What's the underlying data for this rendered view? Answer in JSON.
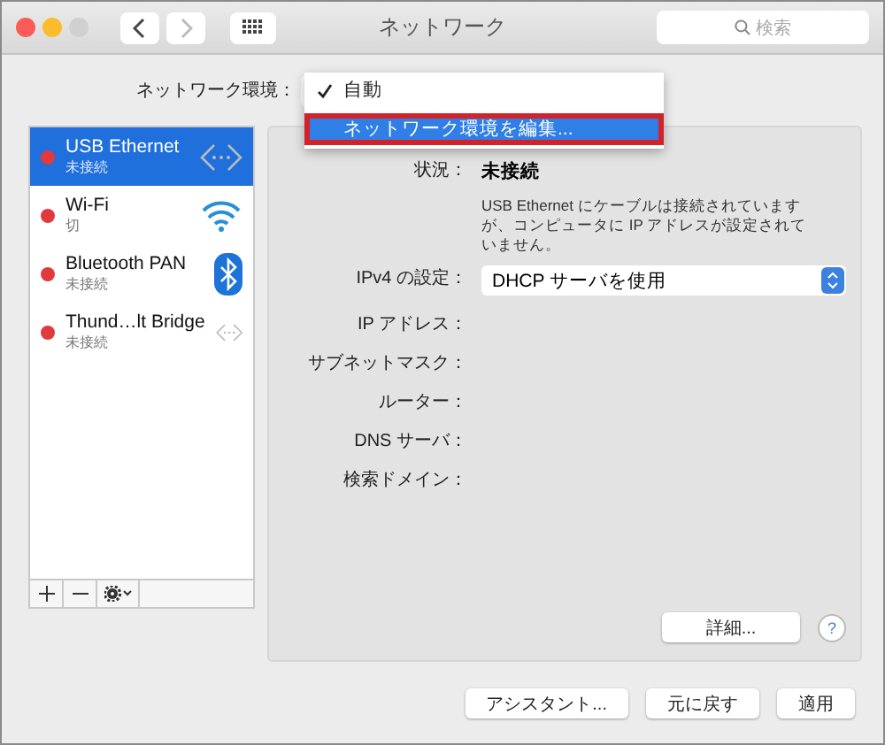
{
  "window": {
    "title": "ネットワーク",
    "search_placeholder": "検索"
  },
  "location": {
    "label": "ネットワーク環境：",
    "menu": [
      {
        "label": "自動",
        "checked": true,
        "selected": false,
        "annotated": false
      },
      {
        "label": "ネットワーク環境を編集...",
        "checked": false,
        "selected": true,
        "annotated": true
      }
    ]
  },
  "services": [
    {
      "name": "USB Ethernet",
      "status": "未接続",
      "color": "#e0393e",
      "kind": "ethernet",
      "selected": true
    },
    {
      "name": "Wi-Fi",
      "status": "切",
      "color": "#e0393e",
      "kind": "wifi",
      "selected": false
    },
    {
      "name": "Bluetooth PAN",
      "status": "未接続",
      "color": "#e0393e",
      "kind": "bluetooth",
      "selected": false
    },
    {
      "name": "Thund…lt Bridge",
      "status": "未接続",
      "color": "#e0393e",
      "kind": "ethernet",
      "selected": false
    }
  ],
  "detail": {
    "status_label": "状況：",
    "status_value": "未接続",
    "description": "USB Ethernet にケーブルは接続されていますが、コンピュータに IP アドレスが設定されていません。",
    "ipv4_label": "IPv4 の設定：",
    "ipv4_value": "DHCP サーバを使用",
    "fields": [
      "IP アドレス：",
      "サブネットマスク：",
      "ルーター：",
      "DNS サーバ：",
      "検索ドメイン："
    ],
    "advanced_button": "詳細...",
    "help": "?"
  },
  "buttons": [
    "アシスタント...",
    "元に戻す",
    "適用"
  ]
}
